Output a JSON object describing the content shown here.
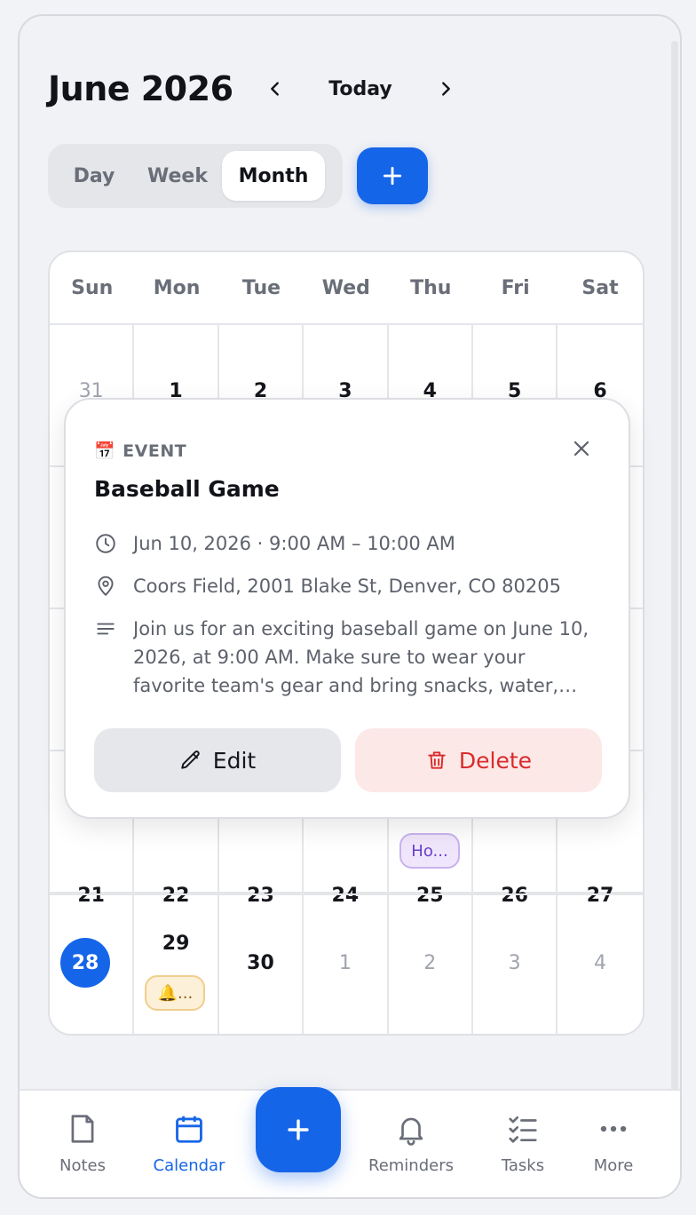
{
  "header": {
    "title": "June 2026",
    "today_label": "Today"
  },
  "view_switch": {
    "day": "Day",
    "week": "Week",
    "month": "Month"
  },
  "calendar": {
    "weekdays": [
      "Sun",
      "Mon",
      "Tue",
      "Wed",
      "Thu",
      "Fri",
      "Sat"
    ],
    "row1": [
      "31",
      "1",
      "2",
      "3",
      "4",
      "5",
      "6"
    ],
    "row4": [
      "21",
      "22",
      "23",
      "24",
      "25",
      "26",
      "27"
    ],
    "row4_chip": "Ho...",
    "row5": [
      "28",
      "29",
      "30",
      "1",
      "2",
      "3",
      "4"
    ],
    "row5_chip": "🔔...",
    "today": "28"
  },
  "event_popup": {
    "type_icon": "📅",
    "type_label": "EVENT",
    "title": "Baseball Game",
    "time": "Jun 10, 2026 · 9:00 AM – 10:00 AM",
    "location": "Coors Field, 2001 Blake St, Denver, CO 80205",
    "description": "Join us for an exciting baseball game on June 10, 2026, at 9:00 AM. Make sure to wear your favorite team's gear and bring snacks, water, and sunscreen for a great day at the ballpark.",
    "edit_label": "Edit",
    "delete_label": "Delete"
  },
  "tabbar": {
    "notes": "Notes",
    "calendar": "Calendar",
    "reminders": "Reminders",
    "tasks": "Tasks",
    "more": "More"
  },
  "colors": {
    "accent": "#1565e8",
    "danger": "#d92b2b",
    "event_purple": "#6a3fc9",
    "reminder_yellow": "#8a5a00"
  }
}
